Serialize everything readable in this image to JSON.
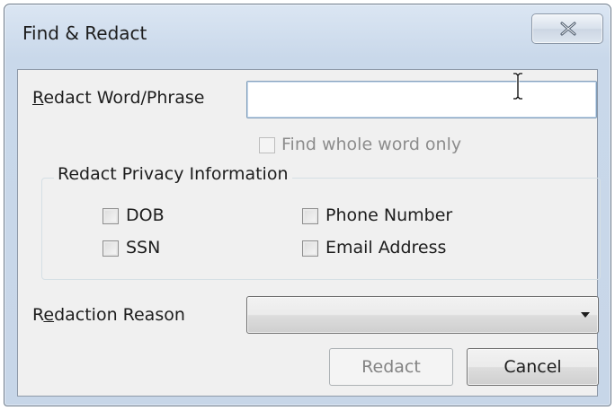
{
  "window": {
    "title": "Find & Redact"
  },
  "redact_phrase": {
    "label_accel": "R",
    "label_rest": "edact Word/Phrase",
    "value": ""
  },
  "whole_word": {
    "label": "Find whole word only",
    "checked": false,
    "enabled": false
  },
  "privacy_group": {
    "title": "Redact Privacy Information",
    "items": [
      {
        "label": "DOB",
        "checked": false
      },
      {
        "label": "SSN",
        "checked": false
      },
      {
        "label": "Phone Number",
        "checked": false
      },
      {
        "label": "Email Address",
        "checked": false
      }
    ]
  },
  "reason": {
    "label_pre": "R",
    "label_accel": "e",
    "label_rest": "daction Reason",
    "selected": ""
  },
  "buttons": {
    "redact": "Redact",
    "cancel": "Cancel"
  },
  "icons": {
    "close": "close-icon",
    "dropdown": "chevron-down-icon",
    "cursor": "ibeam-cursor-icon"
  }
}
